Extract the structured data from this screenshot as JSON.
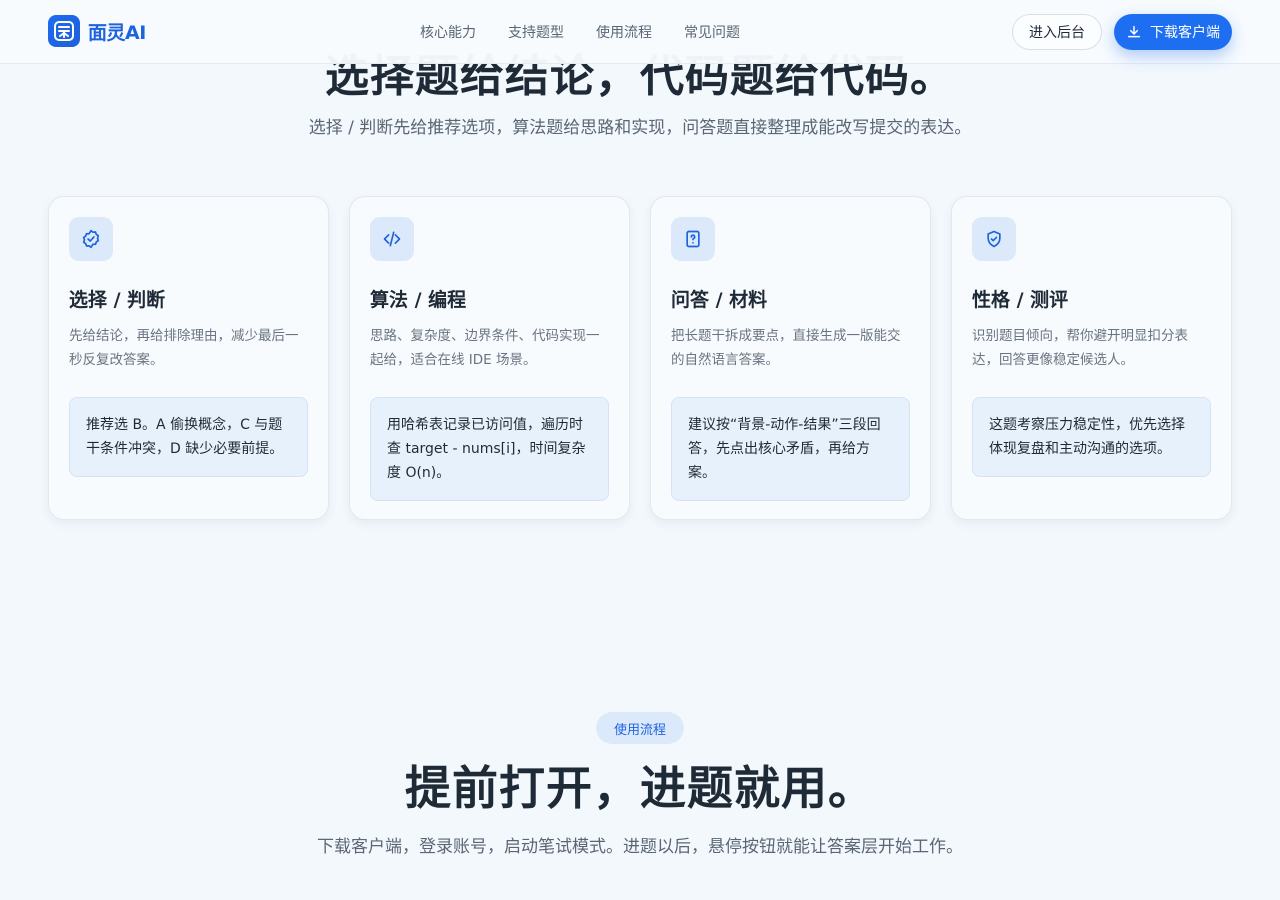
{
  "brand": {
    "name": "面灵AI",
    "logo_glyph": "灵"
  },
  "nav": {
    "items": [
      {
        "label": "核心能力"
      },
      {
        "label": "支持题型"
      },
      {
        "label": "使用流程"
      },
      {
        "label": "常见问题"
      }
    ]
  },
  "header": {
    "admin_label": "进入后台",
    "download_label": "下载客户端"
  },
  "hero": {
    "title": "选择题给结论，代码题给代码。",
    "subtitle": "选择 / 判断先给推荐选项，算法题给思路和实现，问答题直接整理成能改写提交的表达。"
  },
  "cards": [
    {
      "icon": "badge-check-icon",
      "title": "选择 / 判断",
      "desc": "先给结论，再给排除理由，减少最后一秒反复改答案。",
      "example": "推荐选 B。A 偷换概念，C 与题干条件冲突，D 缺少必要前提。"
    },
    {
      "icon": "code-icon",
      "title": "算法 / 编程",
      "desc": "思路、复杂度、边界条件、代码实现一起给，适合在线 IDE 场景。",
      "example": "用哈希表记录已访问值，遍历时查 target - nums[i]，时间复杂度 O(n)。"
    },
    {
      "icon": "file-question-icon",
      "title": "问答 / 材料",
      "desc": "把长题干拆成要点，直接生成一版能交的自然语言答案。",
      "example": "建议按“背景-动作-结果”三段回答，先点出核心矛盾，再给方案。"
    },
    {
      "icon": "shield-check-icon",
      "title": "性格 / 测评",
      "desc": "识别题目倾向，帮你避开明显扣分表达，回答更像稳定候选人。",
      "example": "这题考察压力稳定性，优先选择体现复盘和主动沟通的选项。"
    }
  ],
  "flow": {
    "badge": "使用流程",
    "title": "提前打开，进题就用。",
    "subtitle": "下载客户端，登录账号，启动笔试模式。进题以后，悬停按钮就能让答案层开始工作。"
  },
  "colors": {
    "accent": "#1e6ef2",
    "background": "#f3f8fd",
    "card_icon_bg": "#dce9fb"
  }
}
